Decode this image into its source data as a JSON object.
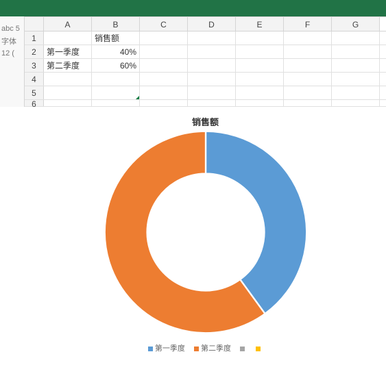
{
  "leftpanel": {
    "l1": "abc 5",
    "l2": "字体",
    "l3": "12 ("
  },
  "columns": [
    "A",
    "B",
    "C",
    "D",
    "E",
    "F",
    "G"
  ],
  "rows": [
    "1",
    "2",
    "3",
    "4",
    "5",
    "6"
  ],
  "cells": {
    "b1": "销售额",
    "a2": "第一季度",
    "b2": "40%",
    "a3": "第二季度",
    "b3": "60%"
  },
  "chart": {
    "title": "销售额",
    "legend": {
      "s1": "第一季度",
      "s2": "第二季度"
    }
  },
  "chart_data": {
    "type": "pie",
    "title": "销售额",
    "categories": [
      "第一季度",
      "第二季度"
    ],
    "values": [
      0.4,
      0.6
    ],
    "colors": [
      "#5b9bd5",
      "#ed7d31"
    ],
    "inner_radius_ratio": 0.58
  }
}
